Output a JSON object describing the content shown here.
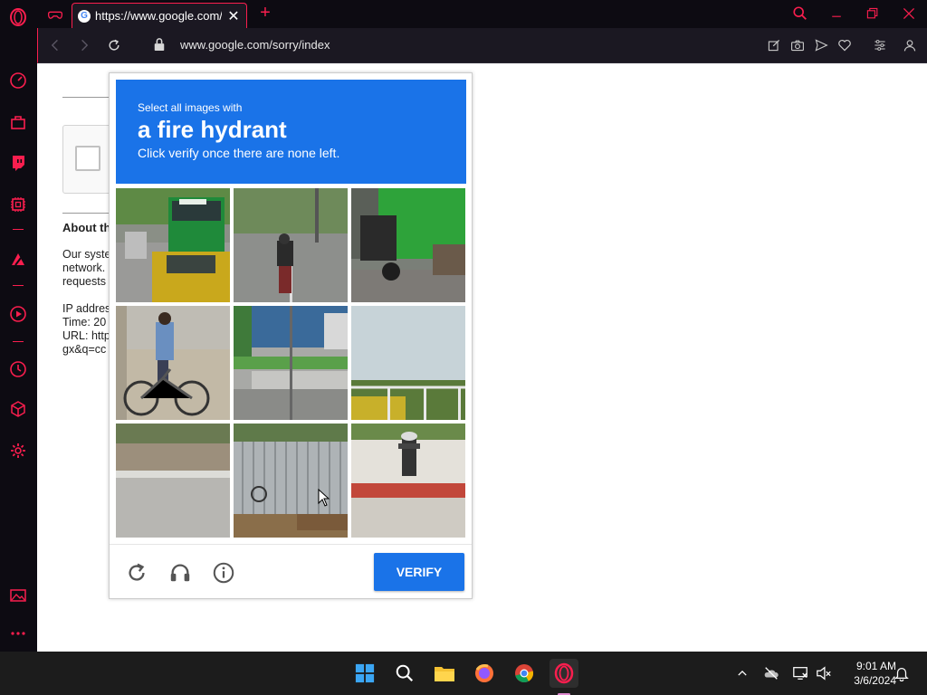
{
  "colors": {
    "accent": "#fa1e4e",
    "captcha_blue": "#1a73e8"
  },
  "browser": {
    "tab": {
      "title": "https://www.google.com/sorry",
      "favicon": "G"
    },
    "address": {
      "url": "www.google.com/sorry/index"
    },
    "new_tab_glyph": "+",
    "close_glyph": "✕"
  },
  "page": {
    "heading": "About th",
    "lines": [
      "Our syste",
      "network.",
      "requests",
      "",
      "IP addres",
      "Time: 20",
      "URL: http",
      "gx&q=cc"
    ]
  },
  "captcha": {
    "instruction_small": "Select all images with",
    "target": "a fire hydrant",
    "instruction_sub": "Click verify once there are none left.",
    "verify_label": "VERIFY",
    "tiles": [
      "Street with green bus and yellow car",
      "Motorcyclist on road",
      "Motorcycle near green wall",
      "Person riding bicycle",
      "Street corner with sign pole",
      "Fence with greenery and sky",
      "Sidewalk curb",
      "Metal fence with bicycle",
      "Fire hydrant on sidewalk"
    ]
  },
  "taskbar": {
    "time": "9:01 AM",
    "date": "3/6/2024"
  }
}
